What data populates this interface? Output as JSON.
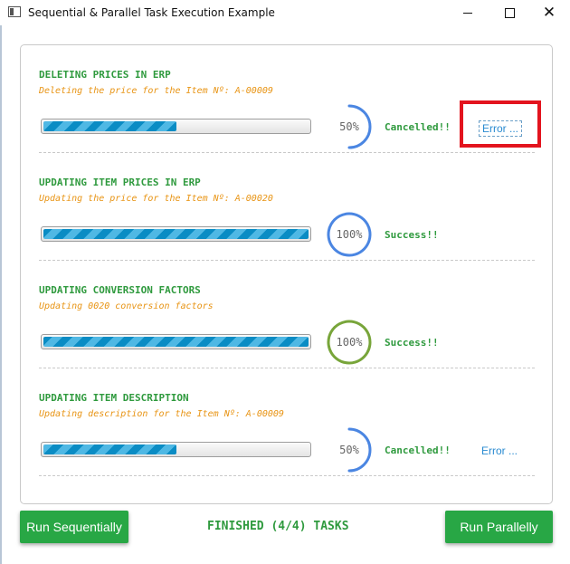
{
  "window": {
    "title": "Sequential & Parallel Task Execution Example",
    "controls": {
      "minimize": "minimize-icon",
      "maximize": "maximize-icon",
      "close": "close-icon"
    }
  },
  "colors": {
    "accent_green": "#28a745",
    "text_green": "#2f9a3e",
    "subtitle_orange": "#e89414",
    "progress_blue": "#0a8cc4",
    "ring_blue": "#4b86e2",
    "ring_green": "#78a53a",
    "link_blue": "#2a8bd1",
    "highlight_red": "#e3141e"
  },
  "tasks": [
    {
      "title": "DELETING PRICES IN ERP",
      "subtitle": "Deleting the price for the Item Nº: A-00009",
      "progress": 0.5,
      "percent_label": "50%",
      "ring_color": "#4b86e2",
      "status": "Cancelled!!",
      "error_label": "Error ..."
    },
    {
      "title": "UPDATING ITEM PRICES IN ERP",
      "subtitle": "Updating the price for the Item Nº: A-00020",
      "progress": 1.0,
      "percent_label": "100%",
      "ring_color": "#4b86e2",
      "status": "Success!!",
      "error_label": ""
    },
    {
      "title": "UPDATING CONVERSION FACTORS",
      "subtitle": "Updating 0020 conversion factors",
      "progress": 1.0,
      "percent_label": "100%",
      "ring_color": "#78a53a",
      "status": "Success!!",
      "error_label": ""
    },
    {
      "title": "UPDATING ITEM DESCRIPTION",
      "subtitle": "Updating description for the Item Nº: A-00009",
      "progress": 0.5,
      "percent_label": "50%",
      "ring_color": "#4b86e2",
      "status": "Cancelled!!",
      "error_label": "Error ..."
    }
  ],
  "footer": {
    "run_sequentially_label": "Run Sequentially",
    "summary": "FINISHED (4/4) TASKS",
    "run_parallelly_label": "Run Parallelly"
  }
}
